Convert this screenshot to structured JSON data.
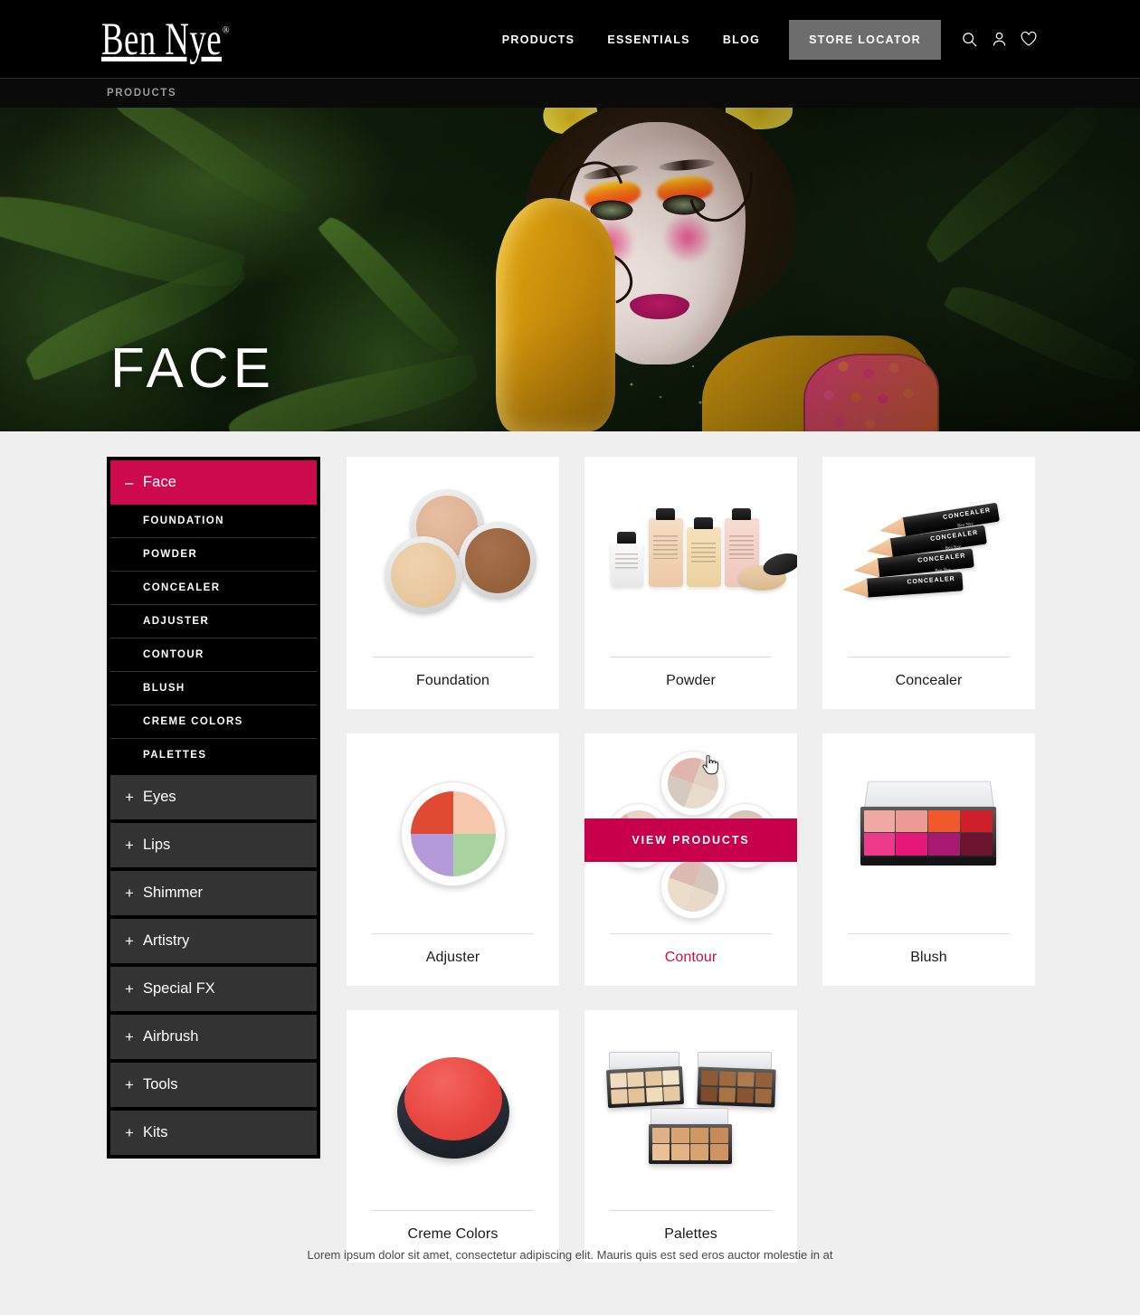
{
  "header": {
    "logo_text": "Ben Nye",
    "logo_trademark": "®",
    "nav_links": [
      {
        "label": "PRODUCTS"
      },
      {
        "label": "ESSENTIALS"
      },
      {
        "label": "BLOG"
      }
    ],
    "store_locator_label": "STORE LOCATOR",
    "icons": [
      {
        "name": "search-icon"
      },
      {
        "name": "account-icon"
      },
      {
        "name": "wishlist-heart-icon"
      }
    ]
  },
  "breadcrumb": {
    "items": [
      {
        "label": "PRODUCTS"
      }
    ]
  },
  "hero": {
    "title": "FACE"
  },
  "sidebar": {
    "active_category": {
      "label": "Face",
      "symbol": "–",
      "accent_color": "#ce0a4e",
      "subitems": [
        {
          "label": "FOUNDATION"
        },
        {
          "label": "POWDER"
        },
        {
          "label": "CONCEALER"
        },
        {
          "label": "ADJUSTER"
        },
        {
          "label": "CONTOUR"
        },
        {
          "label": "BLUSH"
        },
        {
          "label": "CREME COLORS"
        },
        {
          "label": "PALETTES"
        }
      ]
    },
    "collapsed_categories": [
      {
        "label": "Eyes",
        "symbol": "+"
      },
      {
        "label": "Lips",
        "symbol": "+"
      },
      {
        "label": "Shimmer",
        "symbol": "+"
      },
      {
        "label": "Artistry",
        "symbol": "+"
      },
      {
        "label": "Special FX",
        "symbol": "+"
      },
      {
        "label": "Airbrush",
        "symbol": "+"
      },
      {
        "label": "Tools",
        "symbol": "+"
      },
      {
        "label": "Kits",
        "symbol": "+"
      }
    ]
  },
  "products": {
    "hover_label": "VIEW PRODUCTS",
    "cards": [
      {
        "label": "Foundation",
        "art": "foundation",
        "hovered": false
      },
      {
        "label": "Powder",
        "art": "powder",
        "hovered": false
      },
      {
        "label": "Concealer",
        "art": "concealer",
        "hovered": false
      },
      {
        "label": "Adjuster",
        "art": "adjuster",
        "hovered": false
      },
      {
        "label": "Contour",
        "art": "contour",
        "hovered": true
      },
      {
        "label": "Blush",
        "art": "blush",
        "hovered": false
      },
      {
        "label": "Creme Colors",
        "art": "creme",
        "hovered": false
      },
      {
        "label": "Palettes",
        "art": "palettes",
        "hovered": false
      }
    ]
  },
  "footer": {
    "body_text": "Lorem ipsum dolor sit amet, consectetur adipiscing elit. Mauris quis est sed eros auctor molestie in at"
  },
  "theme": {
    "accent": "#ce0a4e",
    "overlay_accent": "#c8004b",
    "header_bg": "#000000",
    "page_bg": "#efefef",
    "store_locator_bg": "#6d6d6d",
    "collapsed_item_bg": "#333333"
  }
}
